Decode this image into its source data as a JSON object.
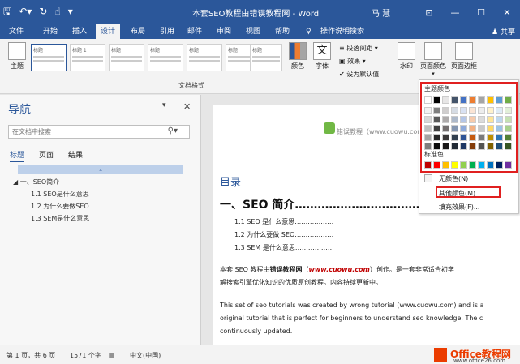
{
  "window": {
    "title": "本套SEO教程由错误教程网 - Word",
    "user": "马 慧",
    "qat_icons": [
      "save-icon",
      "undo-icon",
      "redo-icon",
      "touch-mode-icon",
      "customize-icon"
    ],
    "controls": [
      "minimize-icon",
      "maximize-icon",
      "close-icon"
    ]
  },
  "tabs": {
    "items": [
      "文件",
      "开始",
      "插入",
      "设计",
      "布局",
      "引用",
      "邮件",
      "审阅",
      "视图",
      "帮助"
    ],
    "active": "设计",
    "tell_me": "操作说明搜索",
    "share": "共享"
  },
  "ribbon": {
    "theme_label": "主题",
    "style_thumbs": [
      "标题",
      "标题 1",
      "标题",
      "标题",
      "标题",
      "标题",
      "标题"
    ],
    "colors_label": "颜色",
    "fonts_label": "字体",
    "para_spacing": "段落间距",
    "effects": "效果",
    "set_default": "设为默认值",
    "group_label": "文档格式",
    "watermark": "水印",
    "page_color": "页面颜色",
    "page_borders": "页面边框"
  },
  "nav": {
    "title": "导航",
    "search_placeholder": "在文档中搜索",
    "tabs": [
      "标题",
      "页面",
      "结果"
    ],
    "active_tab": "标题",
    "items": [
      {
        "text": "一、SEO简介",
        "level": 1
      },
      {
        "text": "1.1 SEO是什么意思",
        "level": 2
      },
      {
        "text": "1.2 为什么要做SEO",
        "level": 2
      },
      {
        "text": "1.3 SEM是什么意思",
        "level": 2
      }
    ]
  },
  "document": {
    "watermark": "错误教程（www.cuowu.com）",
    "toc_title": "目录",
    "heading": "一、SEO 简介…………………………………",
    "toc_items": [
      "1.1 SEO 是什么意思………………",
      "1.2 为什么要做 SEO………………",
      "1.3 SEM 是什么意思………………"
    ],
    "para1_a": "本套 SEO 教程由",
    "para1_b": "错误教程网",
    "para1_c": "（",
    "para1_d": "www.cuowu.com",
    "para1_e": "）创作。是一套非常适合初学",
    "para2": "解搜索引擎优化知识的优质原创教程。内容持续更新中。",
    "para3": "This set of seo tutorials was created by wrong tutorial (www.cuowu.com) and is a",
    "para4": "original tutorial that is perfect for beginners to understand seo knowledge. The c",
    "para5": "continuously updated."
  },
  "status": {
    "page": "第 1 页，共 6 页",
    "words": "1571 个字",
    "lang": "中文(中国)",
    "brand": "Office教程网",
    "site": "www.office26.com"
  },
  "color_menu": {
    "theme_label": "主题颜色",
    "standard_label": "标准色",
    "no_color": "无颜色(N)",
    "more_colors": "其他颜色(M)...",
    "fill_effects": "填充效果(F)...",
    "theme_colors": [
      [
        "#ffffff",
        "#000000",
        "#e7e6e6",
        "#44546a",
        "#4472c4",
        "#ed7d31",
        "#a5a5a5",
        "#ffc000",
        "#5b9bd5",
        "#70ad47"
      ],
      [
        "#f2f2f2",
        "#7f7f7f",
        "#d0cece",
        "#d6dce4",
        "#d9e2f3",
        "#fbe5d5",
        "#ededed",
        "#fff2cc",
        "#deebf6",
        "#e2efd9"
      ],
      [
        "#d8d8d8",
        "#595959",
        "#aeabab",
        "#adb9ca",
        "#b4c6e7",
        "#f7cbac",
        "#dbdbdb",
        "#fee599",
        "#bdd7ee",
        "#c5e0b3"
      ],
      [
        "#bfbfbf",
        "#3f3f3f",
        "#757070",
        "#8496b0",
        "#8eaadb",
        "#f4b183",
        "#c9c9c9",
        "#ffd965",
        "#9cc3e5",
        "#a8d08d"
      ],
      [
        "#a5a5a5",
        "#262626",
        "#3a3838",
        "#323f4f",
        "#2f5496",
        "#c55a11",
        "#7b7b7b",
        "#bf9000",
        "#2e75b5",
        "#538135"
      ],
      [
        "#7f7f7f",
        "#0c0c0c",
        "#171616",
        "#222a35",
        "#1f3864",
        "#833c0b",
        "#525252",
        "#7f6000",
        "#1e4e79",
        "#375623"
      ]
    ],
    "standard_colors": [
      "#c00000",
      "#ff0000",
      "#ffc000",
      "#ffff00",
      "#92d050",
      "#00b050",
      "#00b0f0",
      "#0070c0",
      "#002060",
      "#7030a0"
    ]
  }
}
